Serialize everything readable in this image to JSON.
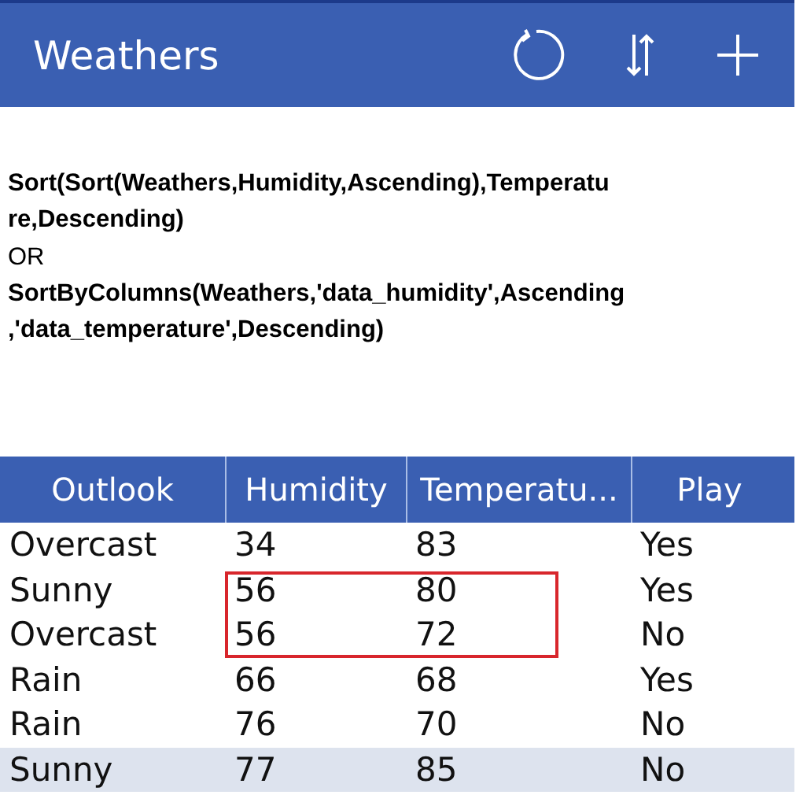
{
  "header": {
    "title": "Weathers",
    "actions": [
      {
        "kind": "refresh"
      },
      {
        "kind": "sort"
      },
      {
        "kind": "add"
      }
    ]
  },
  "formula": {
    "lines": [
      "**Sort(Sort(Weathers,Humidity,Ascending),Temperatu**",
      "**re,Descending)**",
      "OR",
      "**SortByColumns(Weathers,'data_humidity',Ascending**",
      "**,'data_temperature',Descending)**"
    ]
  },
  "table": {
    "columns": [
      "Outlook",
      "Humidity",
      "Temperatu...",
      "Play"
    ],
    "rows": [
      {
        "cells": [
          "Overcast",
          "34",
          "83",
          "Yes"
        ],
        "selected": false,
        "highlighted": false
      },
      {
        "cells": [
          "Sunny",
          "56",
          "80",
          "Yes"
        ],
        "selected": false,
        "highlighted": true
      },
      {
        "cells": [
          "Overcast",
          "56",
          "72",
          "No"
        ],
        "selected": false,
        "highlighted": true
      },
      {
        "cells": [
          "Rain",
          "66",
          "68",
          "Yes"
        ],
        "selected": false,
        "highlighted": false
      },
      {
        "cells": [
          "Rain",
          "76",
          "70",
          "No"
        ],
        "selected": false,
        "highlighted": false
      },
      {
        "cells": [
          "Sunny",
          "77",
          "85",
          "No"
        ],
        "selected": true,
        "highlighted": false
      }
    ]
  }
}
